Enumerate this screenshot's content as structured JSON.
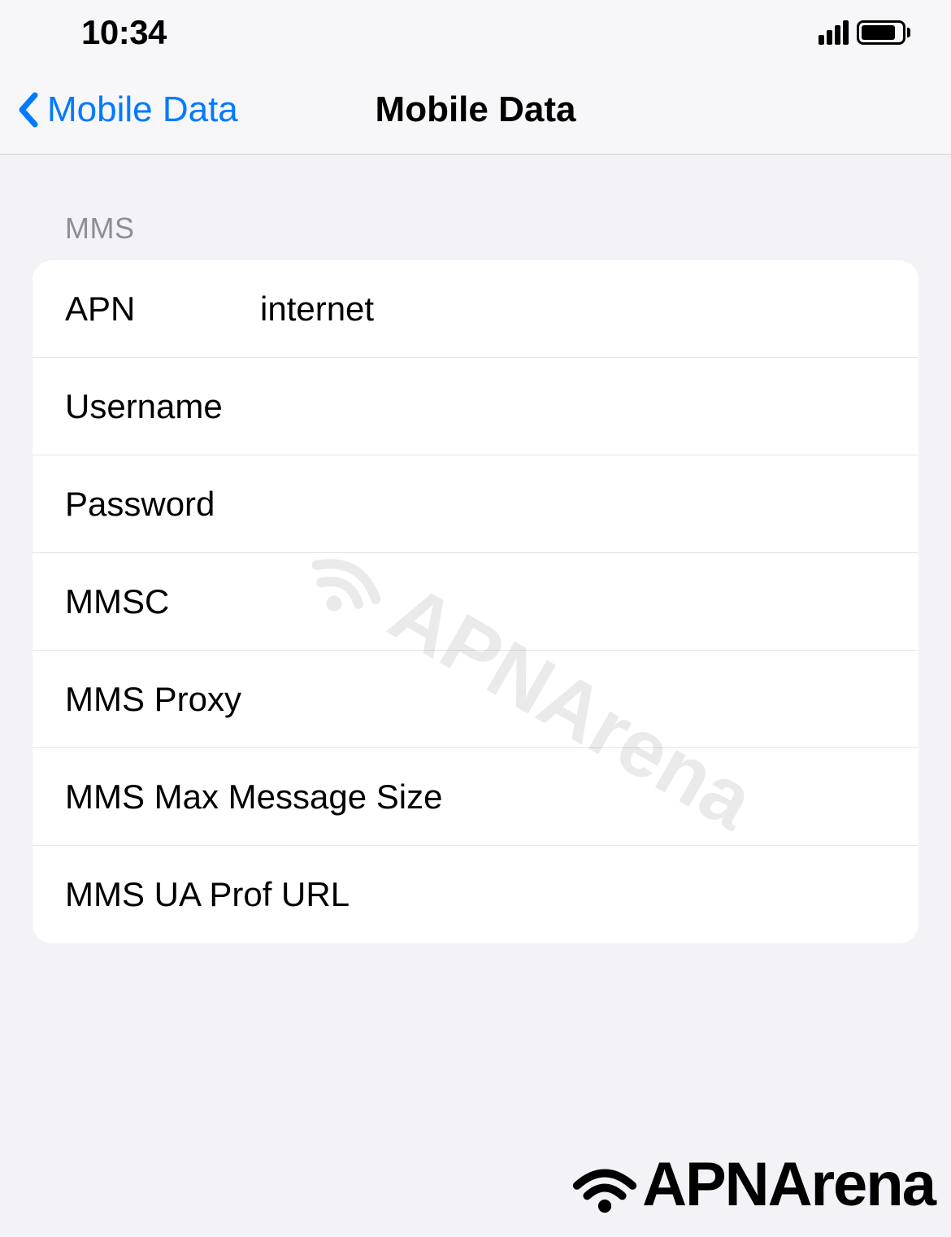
{
  "statusBar": {
    "time": "10:34"
  },
  "nav": {
    "backLabel": "Mobile Data",
    "title": "Mobile Data"
  },
  "section": {
    "header": "MMS",
    "rows": [
      {
        "label": "APN",
        "value": "internet"
      },
      {
        "label": "Username",
        "value": ""
      },
      {
        "label": "Password",
        "value": ""
      },
      {
        "label": "MMSC",
        "value": ""
      },
      {
        "label": "MMS Proxy",
        "value": ""
      },
      {
        "label": "MMS Max Message Size",
        "value": ""
      },
      {
        "label": "MMS UA Prof URL",
        "value": ""
      }
    ]
  },
  "watermark": {
    "text": "APNArena"
  },
  "bottomLogo": {
    "text": "APNArena"
  }
}
